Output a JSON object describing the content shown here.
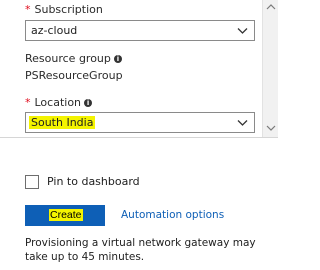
{
  "form": {
    "subscription": {
      "label": "Subscription",
      "required_mark": "*",
      "value": "az-cloud"
    },
    "resource_group": {
      "label": "Resource group",
      "info_glyph": "i",
      "value": "PSResourceGroup"
    },
    "location": {
      "label": "Location",
      "required_mark": "*",
      "info_glyph": "i",
      "value": "South India",
      "highlight_color": "#f4f400"
    }
  },
  "footer": {
    "pin_label": "Pin to dashboard",
    "pin_checked": false,
    "create_label": "Create",
    "automation_label": "Automation options",
    "note": "Provisioning a virtual network gateway may take up to 45 minutes."
  },
  "colors": {
    "accent": "#0e5fb6",
    "required": "#e00b1c",
    "highlight": "#f4f400"
  },
  "icons": {
    "dropdown": "chevron-down-icon",
    "info": "info-icon",
    "scroll_up": "scroll-up-arrow-icon",
    "scroll_down": "scroll-down-arrow-icon"
  }
}
